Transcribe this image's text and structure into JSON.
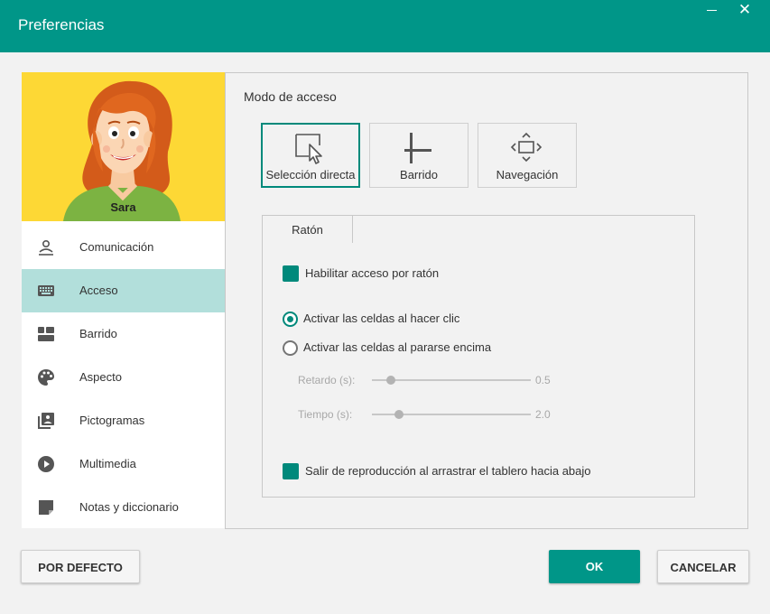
{
  "window": {
    "title": "Preferencias",
    "close_glyph": "✕",
    "accent_color": "#009688"
  },
  "profile": {
    "name": "Sara",
    "background_color": "#fdd835"
  },
  "sidebar": {
    "items": [
      {
        "label": "Comunicación",
        "icon": "communication-icon",
        "active": false
      },
      {
        "label": "Acceso",
        "icon": "keyboard-icon",
        "active": true
      },
      {
        "label": "Barrido",
        "icon": "scan-icon",
        "active": false
      },
      {
        "label": "Aspecto",
        "icon": "palette-icon",
        "active": false
      },
      {
        "label": "Pictogramas",
        "icon": "pictograms-icon",
        "active": false
      },
      {
        "label": "Multimedia",
        "icon": "play-circle-icon",
        "active": false
      },
      {
        "label": "Notas y diccionario",
        "icon": "note-icon",
        "active": false
      }
    ]
  },
  "access": {
    "section_title": "Modo de acceso",
    "modes": [
      {
        "label": "Selección directa",
        "icon": "cursor-select-icon",
        "selected": true
      },
      {
        "label": "Barrido",
        "icon": "scan-bar-icon",
        "selected": false
      },
      {
        "label": "Navegación",
        "icon": "navigation-arrows-icon",
        "selected": false
      }
    ],
    "tab_label": "Ratón",
    "enable_mouse_label": "Habilitar acceso por ratón",
    "enable_mouse_checked": true,
    "radio_click_label": "Activar las celdas al hacer clic",
    "radio_hover_label": "Activar las celdas al pararse encima",
    "radio_selected": "click",
    "delay_label": "Retardo (s):",
    "delay_value": "0.5",
    "delay_fraction": 0.12,
    "time_label": "Tiempo (s):",
    "time_value": "2.0",
    "time_fraction": 0.17,
    "exit_playback_label": "Salir de reproducción al arrastrar el tablero hacia abajo",
    "exit_playback_checked": true
  },
  "footer": {
    "default_label": "POR DEFECTO",
    "ok_label": "OK",
    "cancel_label": "CANCELAR"
  }
}
